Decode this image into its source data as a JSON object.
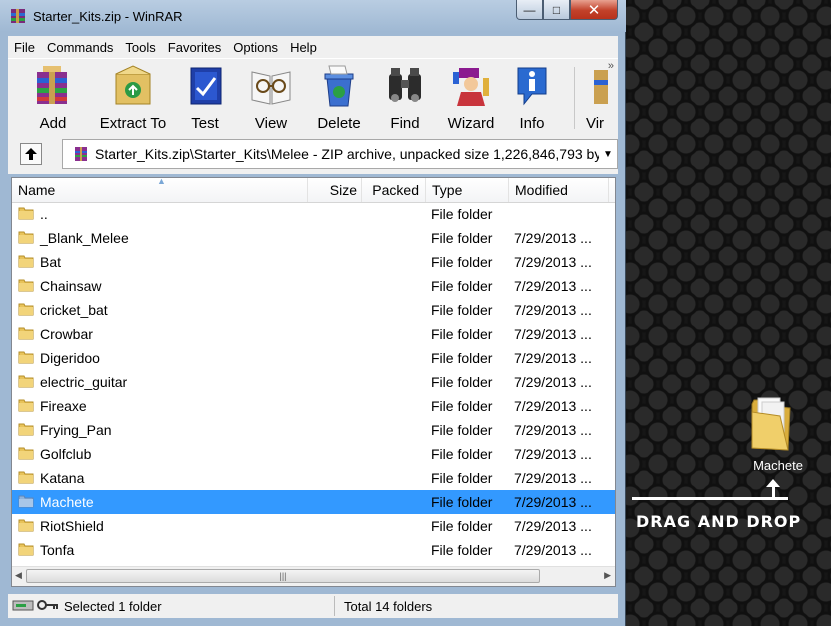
{
  "window": {
    "title": "Starter_Kits.zip - WinRAR",
    "buttons": {
      "minimize": "—",
      "maximize": "□",
      "close": "✕"
    }
  },
  "menu": [
    "File",
    "Commands",
    "Tools",
    "Favorites",
    "Options",
    "Help"
  ],
  "toolbar": {
    "items": [
      {
        "label": "Add",
        "icon": "add-archive-icon"
      },
      {
        "label": "Extract To",
        "icon": "extract-to-icon"
      },
      {
        "label": "Test",
        "icon": "test-icon"
      },
      {
        "label": "View",
        "icon": "view-icon"
      },
      {
        "label": "Delete",
        "icon": "delete-icon"
      },
      {
        "label": "Find",
        "icon": "find-binoculars-icon"
      },
      {
        "label": "Wizard",
        "icon": "wizard-icon"
      },
      {
        "label": "Info",
        "icon": "info-icon"
      },
      {
        "label": "Vir",
        "icon": "virus-scan-icon"
      }
    ],
    "overflow": "»"
  },
  "address": {
    "path": "Starter_Kits.zip\\Starter_Kits\\Melee - ZIP archive, unpacked size 1,226,846,793 bytes",
    "dropdown": "▼"
  },
  "columns": [
    "Name",
    "Size",
    "Packed",
    "Type",
    "Modified"
  ],
  "sort_arrow": "▲",
  "files": [
    {
      "name": "..",
      "type": "File folder",
      "modified": ""
    },
    {
      "name": "_Blank_Melee",
      "type": "File folder",
      "modified": "7/29/2013 ..."
    },
    {
      "name": "Bat",
      "type": "File folder",
      "modified": "7/29/2013 ..."
    },
    {
      "name": "Chainsaw",
      "type": "File folder",
      "modified": "7/29/2013 ..."
    },
    {
      "name": "cricket_bat",
      "type": "File folder",
      "modified": "7/29/2013 ..."
    },
    {
      "name": "Crowbar",
      "type": "File folder",
      "modified": "7/29/2013 ..."
    },
    {
      "name": "Digeridoo",
      "type": "File folder",
      "modified": "7/29/2013 ..."
    },
    {
      "name": "electric_guitar",
      "type": "File folder",
      "modified": "7/29/2013 ..."
    },
    {
      "name": "Fireaxe",
      "type": "File folder",
      "modified": "7/29/2013 ..."
    },
    {
      "name": "Frying_Pan",
      "type": "File folder",
      "modified": "7/29/2013 ..."
    },
    {
      "name": "Golfclub",
      "type": "File folder",
      "modified": "7/29/2013 ..."
    },
    {
      "name": "Katana",
      "type": "File folder",
      "modified": "7/29/2013 ..."
    },
    {
      "name": "Machete",
      "type": "File folder",
      "modified": "7/29/2013 ...",
      "selected": true
    },
    {
      "name": "RiotShield",
      "type": "File folder",
      "modified": "7/29/2013 ..."
    },
    {
      "name": "Tonfa",
      "type": "File folder",
      "modified": "7/29/2013 ..."
    }
  ],
  "scrollbar": {
    "left": "◀",
    "right": "▶",
    "grip": "|||"
  },
  "status": {
    "left": "Selected 1 folder",
    "right": "Total 14 folders"
  },
  "desktop": {
    "folder_label": "Machete",
    "caption": "DRAG AND DROP"
  },
  "colors": {
    "selection": "#3399ff",
    "folder": "#e8c35a",
    "caption": "#ffffff"
  }
}
